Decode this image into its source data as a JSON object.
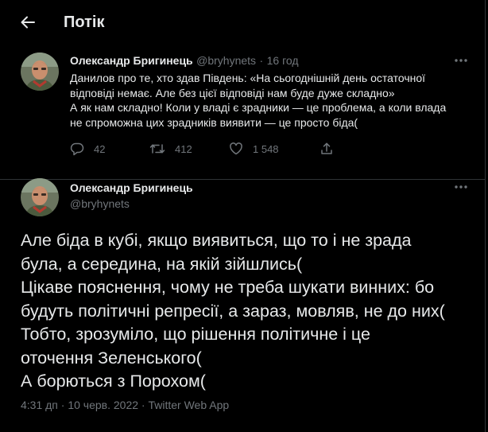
{
  "header": {
    "title": "Потік"
  },
  "tweet": {
    "author_name": "Олександр Бригинець",
    "handle": "@bryhynets",
    "time": "16 год",
    "text": "Данилов про те, хто здав Південь: «На сьогоднішній день остаточної\nвідповіді немає. Але без цієї відповіді нам буде дуже складно»\nА як нам складно! Коли у владі є зрадники — це проблема, а коли влада\nне спроможна цих зрадників виявити — це просто біда(",
    "replies": "42",
    "retweets": "412",
    "likes": "1 548"
  },
  "reply": {
    "author_name": "Олександр Бригинець",
    "handle": "@bryhynets",
    "text": "Але біда в кубі, якщо виявиться, що то і не зрада\nбула, а середина, на якій зійшлись(\nЦікаве пояснення, чому не треба шукати винних: бо\nбудуть політичні репресії, а зараз, мовляв, не до них(\nТобто, зрозуміло, що рішення політичне і це\nоточення Зеленського(\nА борються з Порохом(",
    "timestamp": "4:31 дп · 10 черв. 2022 · Twitter Web App"
  },
  "colors": {
    "background": "#000000",
    "text": "#e7e9ea",
    "muted": "#71767b",
    "border": "#2f3336"
  },
  "icons": [
    "back-arrow-icon",
    "more-icon",
    "reply-icon",
    "retweet-icon",
    "like-icon",
    "share-icon"
  ]
}
